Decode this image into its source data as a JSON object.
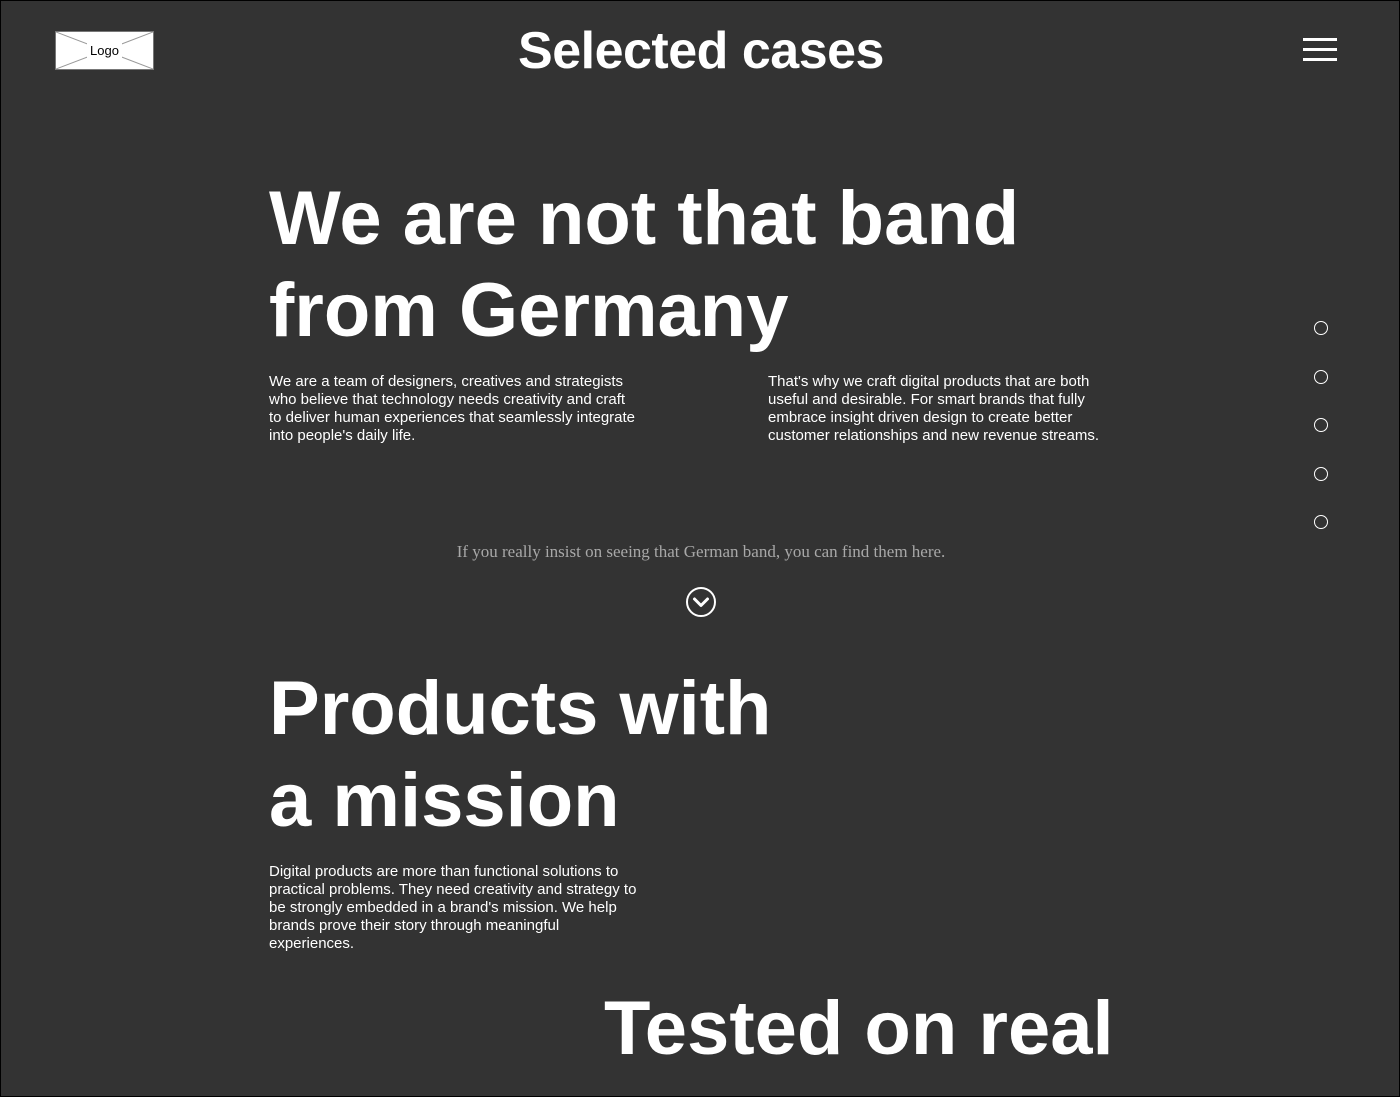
{
  "header": {
    "logo_label": "Logo",
    "title": "Selected cases",
    "menu_icon": "hamburger-menu-icon"
  },
  "section_nav": {
    "icon": "circle-dot-icon",
    "count": 5
  },
  "hero": {
    "heading_line1": "We are not that band",
    "heading_line2": "from Germany",
    "paragraph_left": "We are a team of designers, creatives and strategists who believe that technology needs creativity and craft to deliver human experiences that seamlessly integrate into people's daily life.",
    "paragraph_right": "That's why we craft digital products that are both useful and desirable. For smart brands that fully embrace insight driven design to create better customer relationships and new revenue streams.",
    "hint": "If you really insist on seeing that German band, you can find them here.",
    "scroll_icon": "chevron-down-circle-icon"
  },
  "mission": {
    "heading_line1": "Products with",
    "heading_line2": "a mission",
    "paragraph": "Digital products are more than functional solutions to practical problems. They need creativity and strategy to be strongly embedded in a brand's mission. We help brands prove their story through meaningful experiences."
  },
  "tested": {
    "heading_line1": "Tested on real"
  },
  "colors": {
    "background": "#333333",
    "text": "#ffffff",
    "muted_text": "#a8a8a8"
  }
}
